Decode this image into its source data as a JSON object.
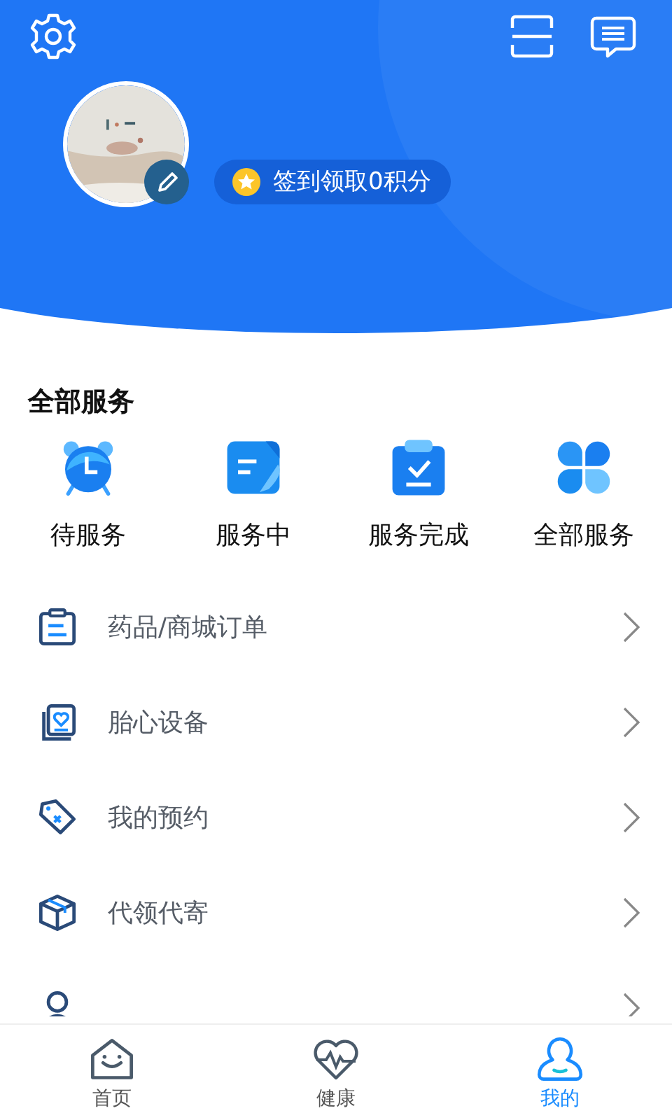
{
  "header": {
    "checkin": "签到领取0积分"
  },
  "services": {
    "title": "全部服务",
    "items": [
      {
        "kind": "clock",
        "label": "待服务"
      },
      {
        "kind": "note",
        "label": "服务中"
      },
      {
        "kind": "done",
        "label": "服务完成"
      },
      {
        "kind": "all",
        "label": "全部服务"
      }
    ]
  },
  "menu": [
    {
      "kind": "clipboard",
      "label": "药品/商城订单"
    },
    {
      "kind": "heart",
      "label": "胎心设备"
    },
    {
      "kind": "tag",
      "label": "我的预约"
    },
    {
      "kind": "box",
      "label": "代领代寄"
    },
    {
      "kind": "person"
    }
  ],
  "tabs": [
    {
      "kind": "home",
      "label": "首页",
      "selected": false
    },
    {
      "kind": "health",
      "label": "健康",
      "selected": false
    },
    {
      "kind": "me",
      "label": "我的",
      "selected": true
    }
  ]
}
